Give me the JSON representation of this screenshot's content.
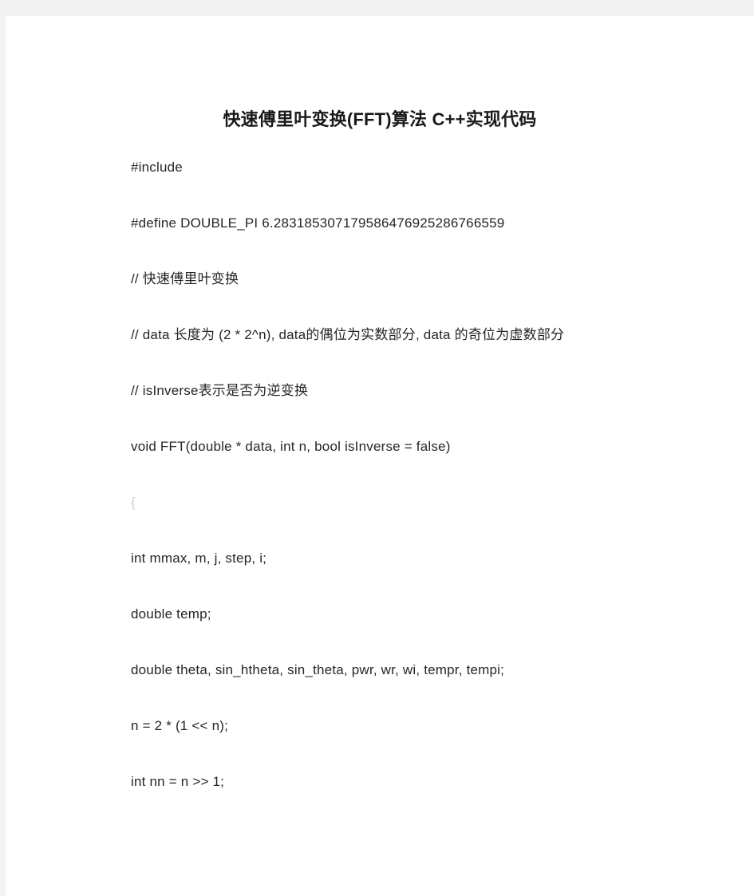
{
  "document": {
    "title": "快速傅里叶变换(FFT)算法 C++实现代码",
    "background_color": "#ffffff",
    "gutter_color": "#f3f3f4",
    "text_color": "#262626",
    "title_color": "#1a1a1a",
    "faint_text_color": "#c9cdd2",
    "lines": [
      {
        "text": "#include",
        "faint": false
      },
      {
        "text": "#define DOUBLE_PI 6.283185307179586476925286766559",
        "faint": false
      },
      {
        "text": "// 快速傅里叶变换",
        "faint": false
      },
      {
        "text": "// data 长度为 (2 * 2^n), data的偶位为实数部分, data 的奇位为虚数部分",
        "faint": false
      },
      {
        "text": "// isInverse表示是否为逆变换",
        "faint": false
      },
      {
        "text": "void FFT(double * data, int n, bool isInverse = false)",
        "faint": false
      },
      {
        "text": "{",
        "faint": true
      },
      {
        "text": "int mmax, m, j, step, i;",
        "faint": false
      },
      {
        "text": "double temp;",
        "faint": false
      },
      {
        "text": "double theta, sin_htheta, sin_theta, pwr, wr, wi, tempr, tempi;",
        "faint": false
      },
      {
        "text": "n = 2 * (1 << n);",
        "faint": false
      },
      {
        "text": "int nn = n >> 1;",
        "faint": false
      }
    ]
  }
}
